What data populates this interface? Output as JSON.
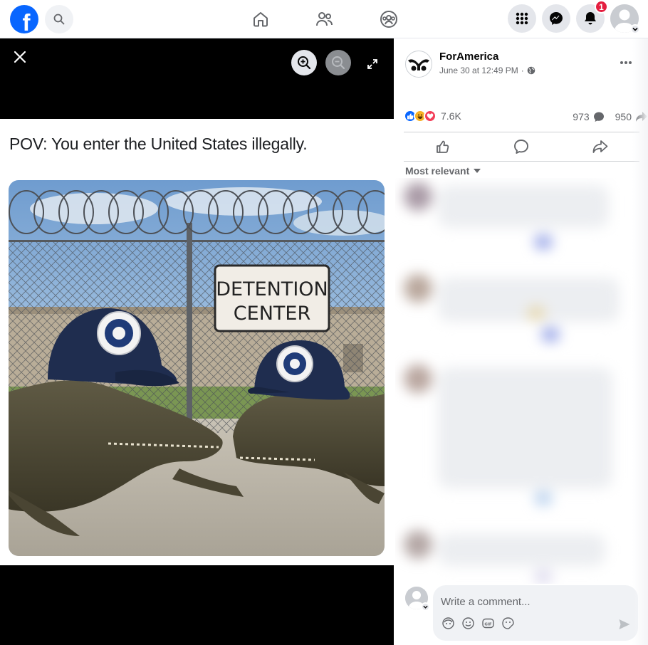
{
  "topbar": {
    "logo_letter": "f",
    "notifications_count": "1"
  },
  "viewer": {
    "caption": "POV: You enter the United States illegally.",
    "sign_line1": "DETENTION",
    "sign_line2": "CENTER"
  },
  "post": {
    "page_name": "ForAmerica",
    "timestamp": "June 30 at 12:49 PM",
    "separator": "·",
    "reaction_count": "7.6K",
    "comment_count": "973",
    "share_count": "950",
    "sort_label": "Most relevant"
  },
  "composer": {
    "placeholder": "Write a comment..."
  },
  "colors": {
    "brand": "#0866ff",
    "like": "#0866ff",
    "love": "#f33e58",
    "haha": "#f7b125",
    "badge": "#e41e3f"
  }
}
